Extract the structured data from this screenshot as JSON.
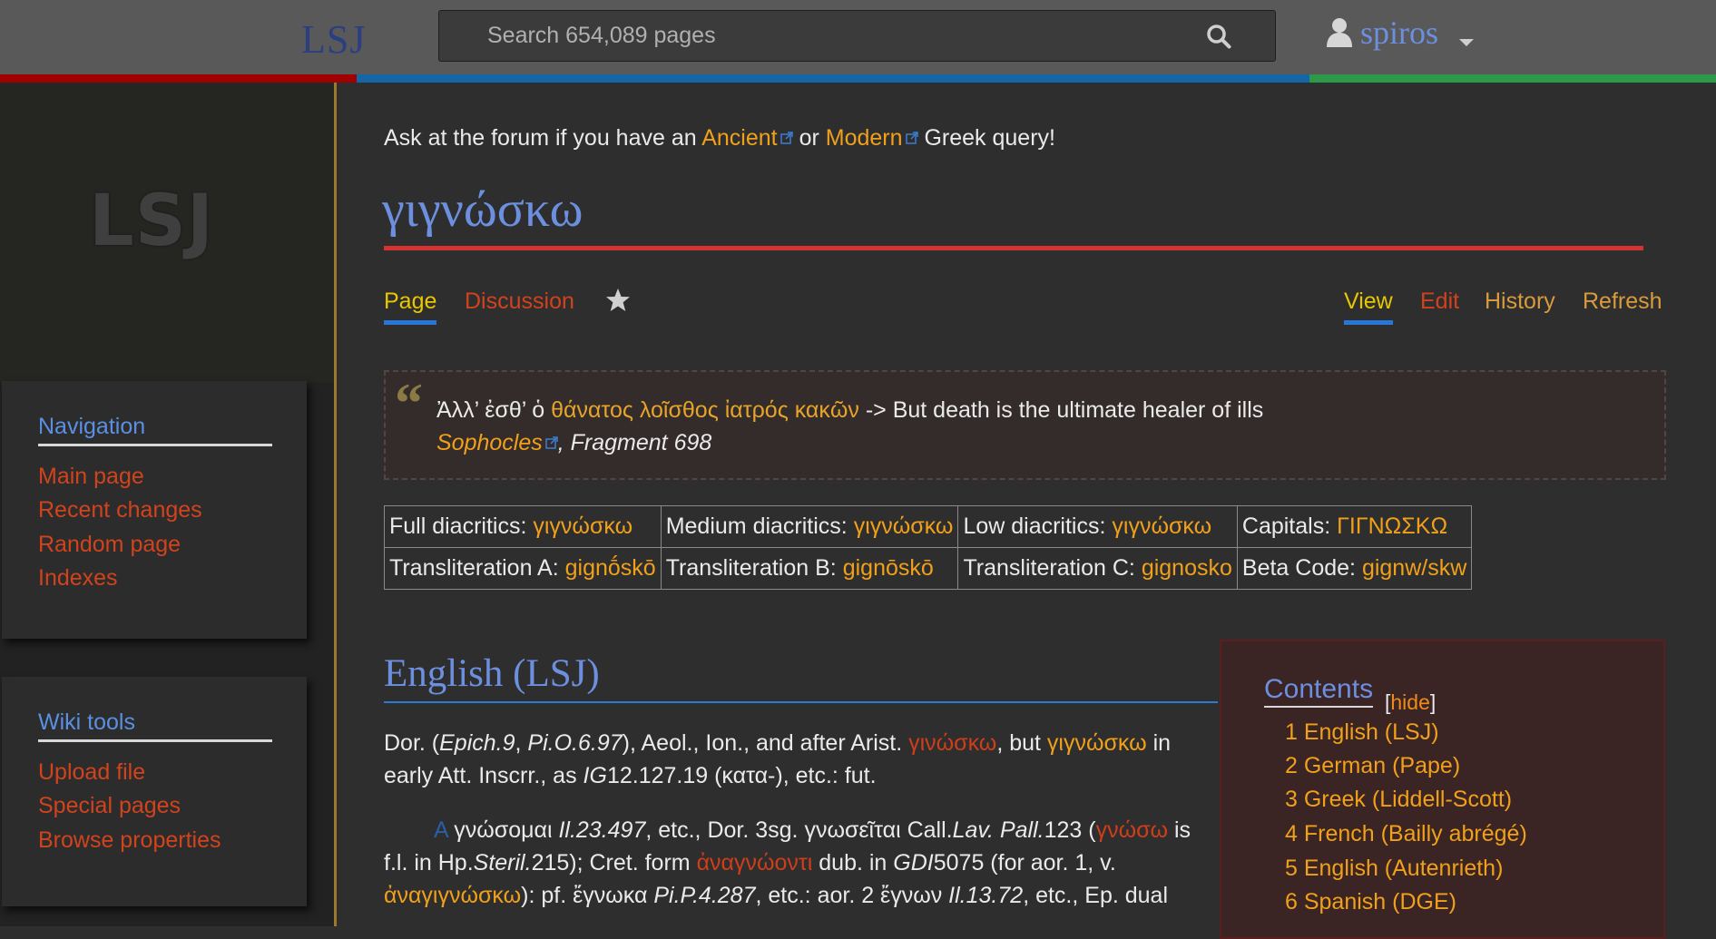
{
  "header": {
    "brand": "LSJ",
    "search_placeholder": "Search 654,089 pages",
    "username": "spiros",
    "stripe_colors": [
      "#a00000",
      "#1466a8",
      "#2c9a48"
    ]
  },
  "sidebar": {
    "logo": "LSJ",
    "navigation": {
      "title": "Navigation",
      "items": [
        "Main page",
        "Recent changes",
        "Random page",
        "Indexes"
      ]
    },
    "wiki_tools": {
      "title": "Wiki tools",
      "items": [
        "Upload file",
        "Special pages",
        "Browse properties"
      ]
    }
  },
  "forum": {
    "prefix": "Ask at the forum if you have an",
    "ancient": "Ancient",
    "or": "or",
    "modern": "Modern",
    "suffix": "Greek query!"
  },
  "page": {
    "title": "γιγνώσκω",
    "tabs_left": [
      "Page",
      "Discussion"
    ],
    "tabs_right": [
      "View",
      "Edit",
      "History",
      "Refresh"
    ]
  },
  "quote": {
    "mark": "“",
    "greek_prefix": "Ἀλλ’ ἐσθ’ ὁ",
    "greek_link": "θάνατος λοῖσθος ἰατρός κακῶν",
    "translation": "-> But death is the ultimate healer of ills",
    "author": "Sophocles",
    "source": ", Fragment 698"
  },
  "forms": {
    "full_label": "Full diacritics:",
    "full_value": "γιγνώσκω",
    "medium_label": "Medium diacritics:",
    "medium_value": "γιγνώσκω",
    "low_label": "Low diacritics:",
    "low_value": "γιγνώσκω",
    "caps_label": "Capitals:",
    "caps_value": "ΓΙΓΝΩΣΚΩ",
    "ta_label": "Transliteration A:",
    "ta_value": "gignṓskō",
    "tb_label": "Transliteration B:",
    "tb_value": "gignōskō",
    "tc_label": "Transliteration C:",
    "tc_value": "gignosko",
    "beta_label": "Beta Code:",
    "beta_value": "gignw/skw"
  },
  "english": {
    "heading": "English (LSJ)",
    "p1": {
      "a": "Dor. (",
      "epich": "Epich.9",
      "b": ", ",
      "pio": "Pi.O.6.97",
      "c": "), Aeol., Ion., and after Arist. ",
      "ginosko": "γινώσκω",
      "d": ", but ",
      "gignosko": "γιγνώσκω",
      "e": " in early Att. Inscrr., as ",
      "ig": "IG",
      "f": "12.127.19 (κατα-), etc.: fut."
    },
    "p2": {
      "a_marker": "A",
      "t1": " γνώσομαι ",
      "il1": "Il.23.497",
      "t2": ", etc., Dor. 3sg. γνωσεῖται Call.",
      "lav": "Lav. Pall.",
      "t3": "123 (",
      "gnoso": "γνώσω",
      "t4": " is f.l. in Hp.",
      "steril": "Steril.",
      "t5": "215); Cret. form ",
      "anagnoonti": "ἀναγνώοντι",
      "t6": " dub. in ",
      "gdi": "GDI",
      "t7": "5075 (for aor. 1, v. ",
      "anagignosko": "ἀναγιγνώσκω",
      "t8": "): pf. ἔγνωκα ",
      "pip": "Pi.P.4.287",
      "t9": ", etc.: aor. 2 ἔγνων ",
      "il2": "Il.13.72",
      "t10": ", etc., Ep. dual"
    }
  },
  "toc": {
    "title": "Contents",
    "hide_open": "[",
    "hide": "hide",
    "hide_close": "]",
    "items": [
      "1 English (LSJ)",
      "2 German (Pape)",
      "3 Greek (Liddell-Scott)",
      "4 French (Bailly abrégé)",
      "5 English (Autenrieth)",
      "6 Spanish (DGE)"
    ]
  }
}
